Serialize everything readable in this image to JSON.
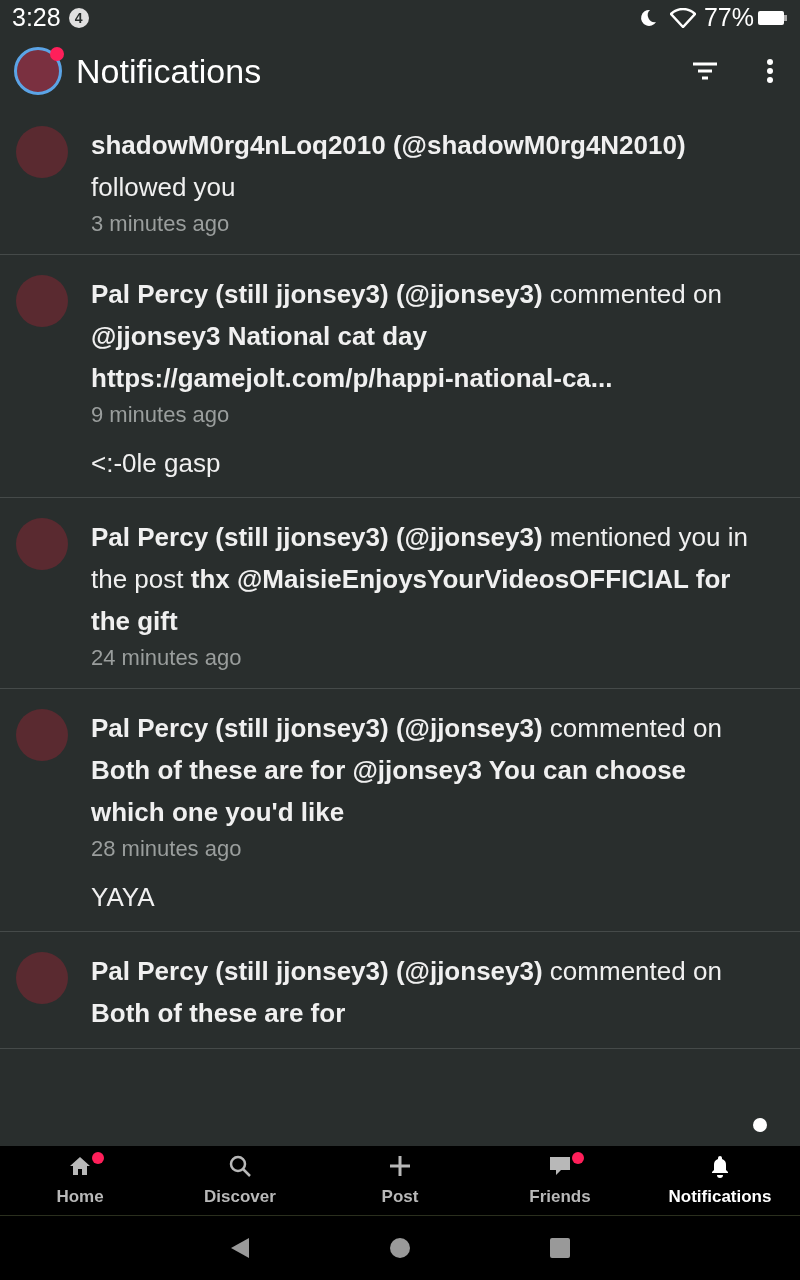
{
  "status_bar": {
    "time": "3:28",
    "notification_count": "4",
    "battery": "77%"
  },
  "app_bar": {
    "title": "Notifications",
    "avatar_unread": true
  },
  "notifications": [
    {
      "text": "**shadowM0rg4nLoq2010 (@shadowM0rg4N2010)** followed you",
      "time": "3 minutes ago"
    },
    {
      "text": "**Pal Percy (still jjonsey3) (@jjonsey3)** commented on **@jjonsey3 National cat day https://gamejolt.com/p/happi-national-ca...**",
      "time": "9 minutes ago",
      "comment": "<:-0le gasp"
    },
    {
      "text": "**Pal Percy (still jjonsey3) (@jjonsey3)** mentioned you in the post **thx @MaisieEnjoysYourVideosOFFICIAL for the gift**",
      "time": "24 minutes ago"
    },
    {
      "text": "**Pal Percy (still jjonsey3) (@jjonsey3)** commented on **Both of these are for @jjonsey3 You can choose which one you'd like**",
      "time": "28 minutes ago",
      "comment": "YAYA"
    },
    {
      "text": "**Pal Percy (still jjonsey3) (@jjonsey3)** commented on **Both of these are for**"
    }
  ],
  "nav": [
    {
      "label": "Home",
      "kind": "home",
      "selected": false,
      "badge": true
    },
    {
      "label": "Discover",
      "kind": "search",
      "selected": false,
      "badge": false
    },
    {
      "label": "Post",
      "kind": "plus",
      "selected": false,
      "badge": false
    },
    {
      "label": "Friends",
      "kind": "chat",
      "selected": false,
      "badge": true
    },
    {
      "label": "Notifications",
      "kind": "bell",
      "selected": true,
      "badge": false
    }
  ]
}
